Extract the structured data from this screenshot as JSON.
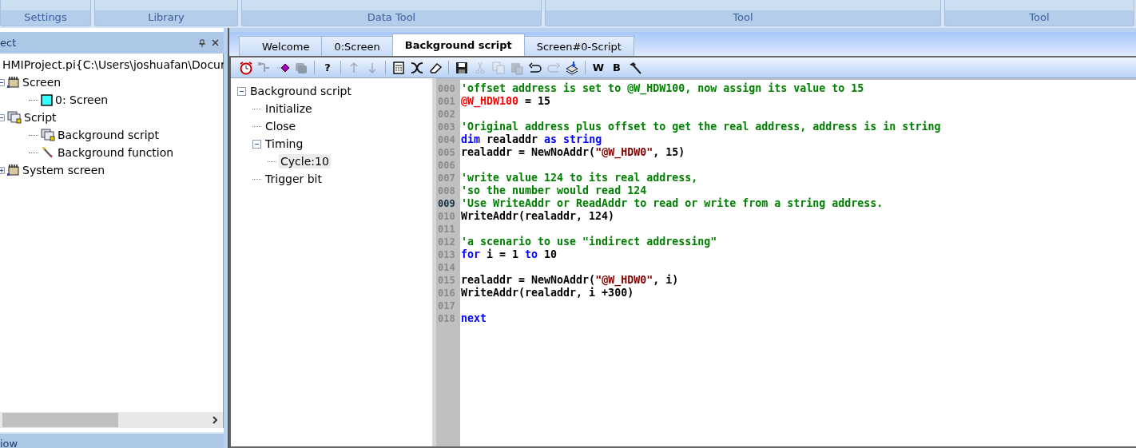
{
  "ribbon_groups": [
    "Settings",
    "Library",
    "Data Tool",
    "Tool",
    "Tool"
  ],
  "project_panel": {
    "title": "ect",
    "tree": [
      {
        "label": "HMIProject.pi{C:\\Users\\joshuafan\\Docur",
        "kind": "project",
        "children": [
          {
            "label": "Screen",
            "kind": "folder",
            "expanded": true,
            "children": [
              {
                "label": "0: Screen",
                "kind": "screen"
              }
            ]
          },
          {
            "label": "Script",
            "kind": "script",
            "expanded": true,
            "children": [
              {
                "label": "Background script",
                "kind": "script"
              },
              {
                "label": "Background function",
                "kind": "function"
              }
            ]
          },
          {
            "label": "System screen",
            "kind": "folder",
            "expanded": false
          }
        ]
      }
    ]
  },
  "bottom_panel": {
    "title": "iow"
  },
  "tabs": [
    {
      "label": "Welcome",
      "selected": false
    },
    {
      "label": "0:Screen",
      "selected": false
    },
    {
      "label": "Background script",
      "selected": true
    },
    {
      "label": "Screen#0-Script",
      "selected": false
    }
  ],
  "toolbar": [
    {
      "kind": "clock",
      "disabled": false
    },
    {
      "kind": "flow",
      "disabled": true
    },
    {
      "kind": "diamond",
      "disabled": false
    },
    {
      "kind": "stack",
      "disabled": true
    },
    {
      "kind": "separator"
    },
    {
      "kind": "text",
      "text": "?",
      "disabled": false
    },
    {
      "kind": "separator"
    },
    {
      "kind": "up",
      "disabled": true
    },
    {
      "kind": "down",
      "disabled": true
    },
    {
      "kind": "separator"
    },
    {
      "kind": "calc",
      "disabled": false
    },
    {
      "kind": "cut",
      "disabled": false
    },
    {
      "kind": "eraser",
      "disabled": false
    },
    {
      "kind": "separator"
    },
    {
      "kind": "save",
      "disabled": false
    },
    {
      "kind": "scissors",
      "disabled": true
    },
    {
      "kind": "copy",
      "disabled": true
    },
    {
      "kind": "paste",
      "disabled": true
    },
    {
      "kind": "undo",
      "disabled": false
    },
    {
      "kind": "redo",
      "disabled": true
    },
    {
      "kind": "import",
      "disabled": false
    },
    {
      "kind": "separator"
    },
    {
      "kind": "text",
      "text": "W",
      "disabled": false
    },
    {
      "kind": "text",
      "text": "B",
      "disabled": false
    },
    {
      "kind": "hammer",
      "disabled": false
    }
  ],
  "script_tree": [
    {
      "label": "Background script",
      "expanded": true,
      "selected": false,
      "children": [
        {
          "label": "Initialize",
          "selected": false
        },
        {
          "label": "Close",
          "selected": false
        },
        {
          "label": "Timing",
          "expanded": true,
          "selected": false,
          "children": [
            {
              "label": "Cycle:10",
              "selected": true
            }
          ]
        },
        {
          "label": "Trigger bit",
          "selected": false
        }
      ]
    }
  ],
  "code": [
    {
      "number": "000",
      "current": false,
      "tokens": [
        {
          "kind": "comment",
          "text": "'offset address is set to @W_HDW100, now assign its value to 15"
        }
      ]
    },
    {
      "number": "001",
      "current": false,
      "tokens": [
        {
          "kind": "address",
          "text": "@W_HDW100"
        },
        {
          "kind": "plain",
          "text": " = 15"
        }
      ]
    },
    {
      "number": "002",
      "current": false
    },
    {
      "number": "003",
      "current": false,
      "tokens": [
        {
          "kind": "comment",
          "text": "'Original address plus offset to get the real address, address is in string"
        }
      ]
    },
    {
      "number": "004",
      "current": false,
      "tokens": [
        {
          "kind": "keyword",
          "text": "dim"
        },
        {
          "kind": "plain",
          "text": " realaddr "
        },
        {
          "kind": "keyword",
          "text": "as string"
        }
      ]
    },
    {
      "number": "005",
      "current": false,
      "tokens": [
        {
          "kind": "plain",
          "text": "realaddr = NewNoAddr("
        },
        {
          "kind": "string",
          "text": "\"@W_HDW0\""
        },
        {
          "kind": "plain",
          "text": ", 15)"
        }
      ]
    },
    {
      "number": "006",
      "current": false
    },
    {
      "number": "007",
      "current": false,
      "tokens": [
        {
          "kind": "comment",
          "text": "'write value 124 to its real address,"
        }
      ]
    },
    {
      "number": "008",
      "current": false,
      "tokens": [
        {
          "kind": "comment",
          "text": "'so the number would read 124"
        }
      ]
    },
    {
      "number": "009",
      "current": true,
      "tokens": [
        {
          "kind": "comment",
          "text": "'Use WriteAddr or ReadAddr to read or write from a string address."
        }
      ]
    },
    {
      "number": "010",
      "current": false,
      "tokens": [
        {
          "kind": "plain",
          "text": "WriteAddr(realaddr, 124)"
        }
      ]
    },
    {
      "number": "011",
      "current": false
    },
    {
      "number": "012",
      "current": false,
      "tokens": [
        {
          "kind": "comment",
          "text": "'a scenario to use \"indirect addressing\""
        }
      ]
    },
    {
      "number": "013",
      "current": false,
      "tokens": [
        {
          "kind": "keyword",
          "text": "for"
        },
        {
          "kind": "plain",
          "text": " i = 1 "
        },
        {
          "kind": "keyword",
          "text": "to"
        },
        {
          "kind": "plain",
          "text": " 10"
        }
      ]
    },
    {
      "number": "014",
      "current": false
    },
    {
      "number": "015",
      "current": false,
      "tokens": [
        {
          "kind": "plain",
          "text": "realaddr = NewNoAddr("
        },
        {
          "kind": "string",
          "text": "\"@W_HDW0\""
        },
        {
          "kind": "plain",
          "text": ", i)"
        }
      ]
    },
    {
      "number": "016",
      "current": false,
      "tokens": [
        {
          "kind": "plain",
          "text": "WriteAddr(realaddr, i +300)"
        }
      ]
    },
    {
      "number": "017",
      "current": false
    },
    {
      "number": "018",
      "current": false,
      "tokens": [
        {
          "kind": "keyword",
          "text": "next"
        }
      ]
    }
  ]
}
